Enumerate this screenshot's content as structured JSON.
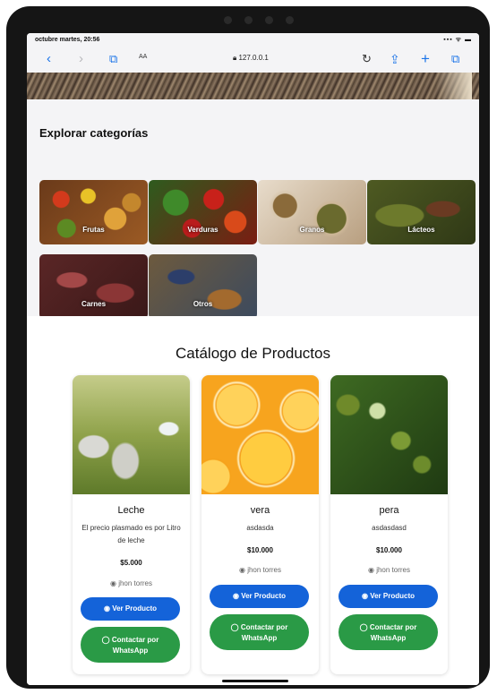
{
  "status": {
    "time": "octubre martes, 20:56",
    "icons": "▪▪▪ ᯤ ▬"
  },
  "browser": {
    "text_size": "AA",
    "url": "127.0.0.1",
    "back": "‹",
    "forward": "›",
    "bookmarks": "⧉",
    "reload": "↻",
    "share": "⇪",
    "new_tab": "+",
    "tabs": "⧉"
  },
  "categories": {
    "title": "Explorar categorías",
    "items": [
      {
        "label": "Frutas"
      },
      {
        "label": "Verduras"
      },
      {
        "label": "Granos"
      },
      {
        "label": "Lácteos"
      },
      {
        "label": "Carnes"
      },
      {
        "label": "Otros"
      }
    ]
  },
  "catalog": {
    "title": "Catálogo de Productos",
    "products": [
      {
        "name": "Leche",
        "description": "El precio plasmado es por Litro de leche",
        "price": "$5.000",
        "seller": "jhon torres",
        "view_label": "Ver Producto",
        "whatsapp_label": "Contactar por WhatsApp"
      },
      {
        "name": "vera",
        "description": "asdasda",
        "price": "$10.000",
        "seller": "jhon torres",
        "view_label": "Ver Producto",
        "whatsapp_label": "Contactar por WhatsApp"
      },
      {
        "name": "pera",
        "description": "asdasdasd",
        "price": "$10.000",
        "seller": "jhon torres",
        "view_label": "Ver Producto",
        "whatsapp_label": "Contactar por WhatsApp"
      }
    ]
  },
  "colors": {
    "primary": "#1463d9",
    "whatsapp": "#2a9a46"
  }
}
